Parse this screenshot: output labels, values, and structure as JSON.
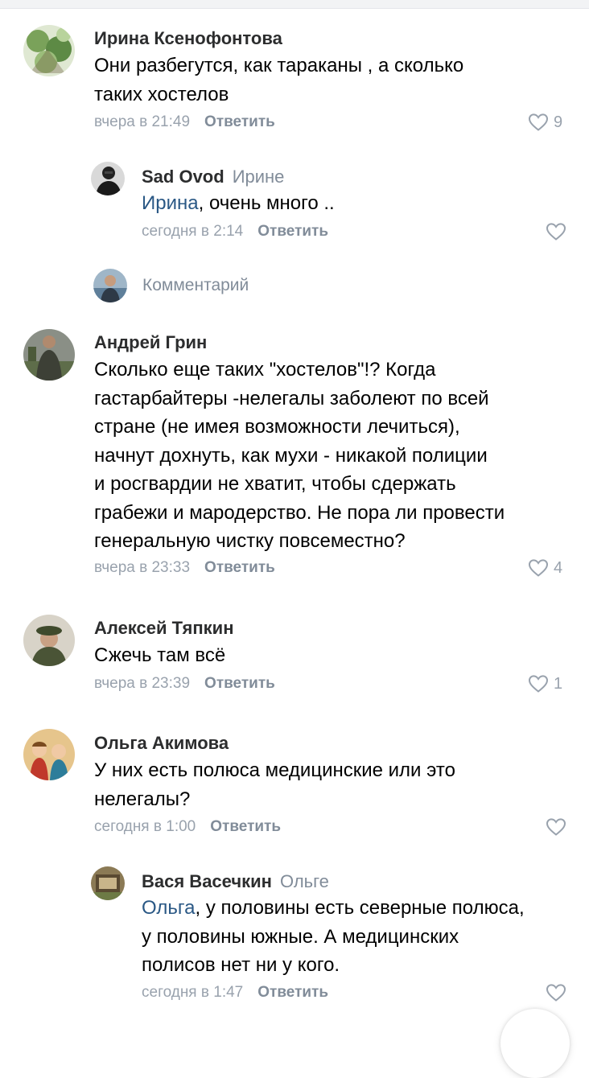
{
  "comments": [
    {
      "author": "Ирина Ксенофонтова",
      "text_lines": [
        "Они разбегутся, как тараканы , а сколько",
        "таких хостелов"
      ],
      "time": "вчера в 21:49",
      "reply_label": "Ответить",
      "likes": "9"
    },
    {
      "author": "Sad Ovod",
      "reply_to": "Ирине",
      "mention": "Ирина",
      "text_rest": ", очень много ..",
      "time": "сегодня в 2:14",
      "reply_label": "Ответить"
    },
    {
      "author": "Андрей Грин",
      "text_lines": [
        "Сколько еще таких \"хостелов\"!? Когда",
        "гастарбайтеры -нелегалы заболеют по всей",
        "стране (не имея возможности лечиться),",
        "начнут дохнуть, как мухи - никакой полиции",
        "и росгвардии не хватит, чтобы сдержать",
        "грабежи и мародерство. Не пора ли провести",
        "генеральную чистку повсеместно?"
      ],
      "time": "вчера в 23:33",
      "reply_label": "Ответить",
      "likes": "4"
    },
    {
      "author": "Алексей Тяпкин",
      "text_lines": [
        "Сжечь там всё"
      ],
      "time": "вчера в 23:39",
      "reply_label": "Ответить",
      "likes": "1"
    },
    {
      "author": "Ольга Акимова",
      "text_lines": [
        "У них есть полюса медицинские или это",
        "нелегалы?"
      ],
      "time": "сегодня в 1:00",
      "reply_label": "Ответить"
    },
    {
      "author": "Вася Васечкин",
      "reply_to": "Ольге",
      "mention": "Ольга",
      "text_first_rest": ", у половины есть северные полюса,",
      "text_lines": [
        "у половины южные. А медицинских",
        "полисов нет ни у кого."
      ],
      "time": "сегодня в 1:47",
      "reply_label": "Ответить"
    }
  ],
  "comment_input": {
    "placeholder": "Комментарий"
  },
  "icons": {
    "like": "heart-outline-icon"
  },
  "colors": {
    "link": "#2a5885",
    "meta": "#99a2ad",
    "reply_button": "#818c99"
  }
}
